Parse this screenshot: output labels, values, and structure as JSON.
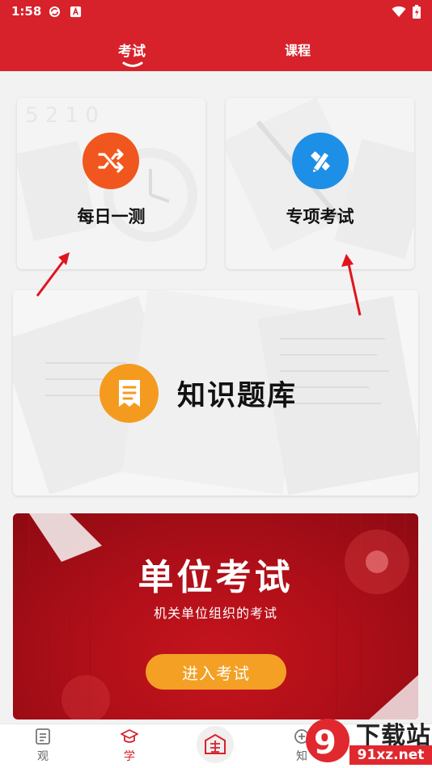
{
  "status_bar": {
    "time": "1:58"
  },
  "tabs": [
    {
      "label": "考试",
      "active": true
    },
    {
      "label": "课程",
      "active": false
    }
  ],
  "cards": {
    "daily": {
      "label": "每日一测",
      "icon": "shuffle-icon",
      "color": "#f0561e"
    },
    "special": {
      "label": "专项考试",
      "icon": "pencil-ruler-icon",
      "color": "#1e8fe6"
    },
    "bank": {
      "label": "知识题库",
      "icon": "document-icon",
      "color": "#f49b1f"
    }
  },
  "promo": {
    "title": "单位考试",
    "subtitle": "机关单位组织的考试",
    "button": "进入考试"
  },
  "bottom_nav": [
    {
      "label": "观",
      "icon": "article-icon",
      "active": false
    },
    {
      "label": "学",
      "icon": "graduation-cap-icon",
      "active": true
    },
    {
      "label": "",
      "icon": "seal-icon",
      "active": false
    },
    {
      "label": "知",
      "icon": "knowledge-icon",
      "active": false
    }
  ],
  "watermark": {
    "title": "下载站",
    "site": "91xz.net"
  },
  "colors": {
    "brand_red": "#d7222b",
    "background": "#f2f2f2",
    "button_orange": "#f3a024"
  }
}
